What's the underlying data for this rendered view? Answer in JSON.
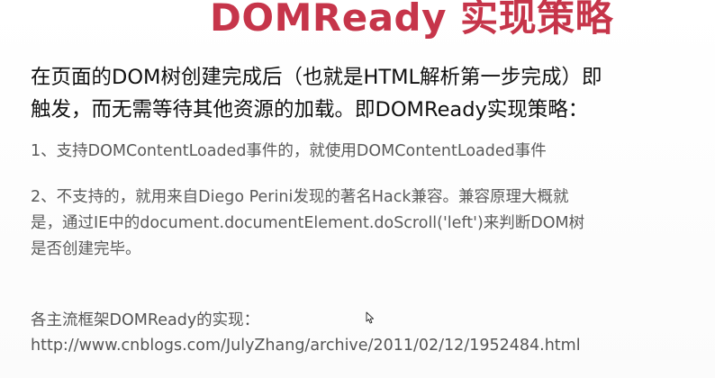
{
  "slide": {
    "title": "DOMReady 实现策略",
    "intro_lines": [
      "在页面的DOM树创建完成后（也就是HTML解析第一步完成）即",
      "触发，而无需等待其他资源的加载。即DOMReady实现策略："
    ],
    "item1": "1、支持DOMContentLoaded事件的，就使用DOMContentLoaded事件",
    "item2_lines": [
      "2、不支持的，就用来自Diego Perini发现的著名Hack兼容。兼容原理大概就",
      "是，通过IE中的document.documentElement.doScroll('left')来判断DOM树",
      "是否创建完毕。"
    ],
    "footer_label": "各主流框架DOMReady的实现：",
    "footer_url": "http://www.cnblogs.com/JulyZhang/archive/2011/02/12/1952484.html"
  },
  "icons": {
    "cursor": "mouse-cursor-icon"
  },
  "colors": {
    "title": "#c6354a",
    "body": "#111111",
    "secondary": "#5a5a5a"
  }
}
